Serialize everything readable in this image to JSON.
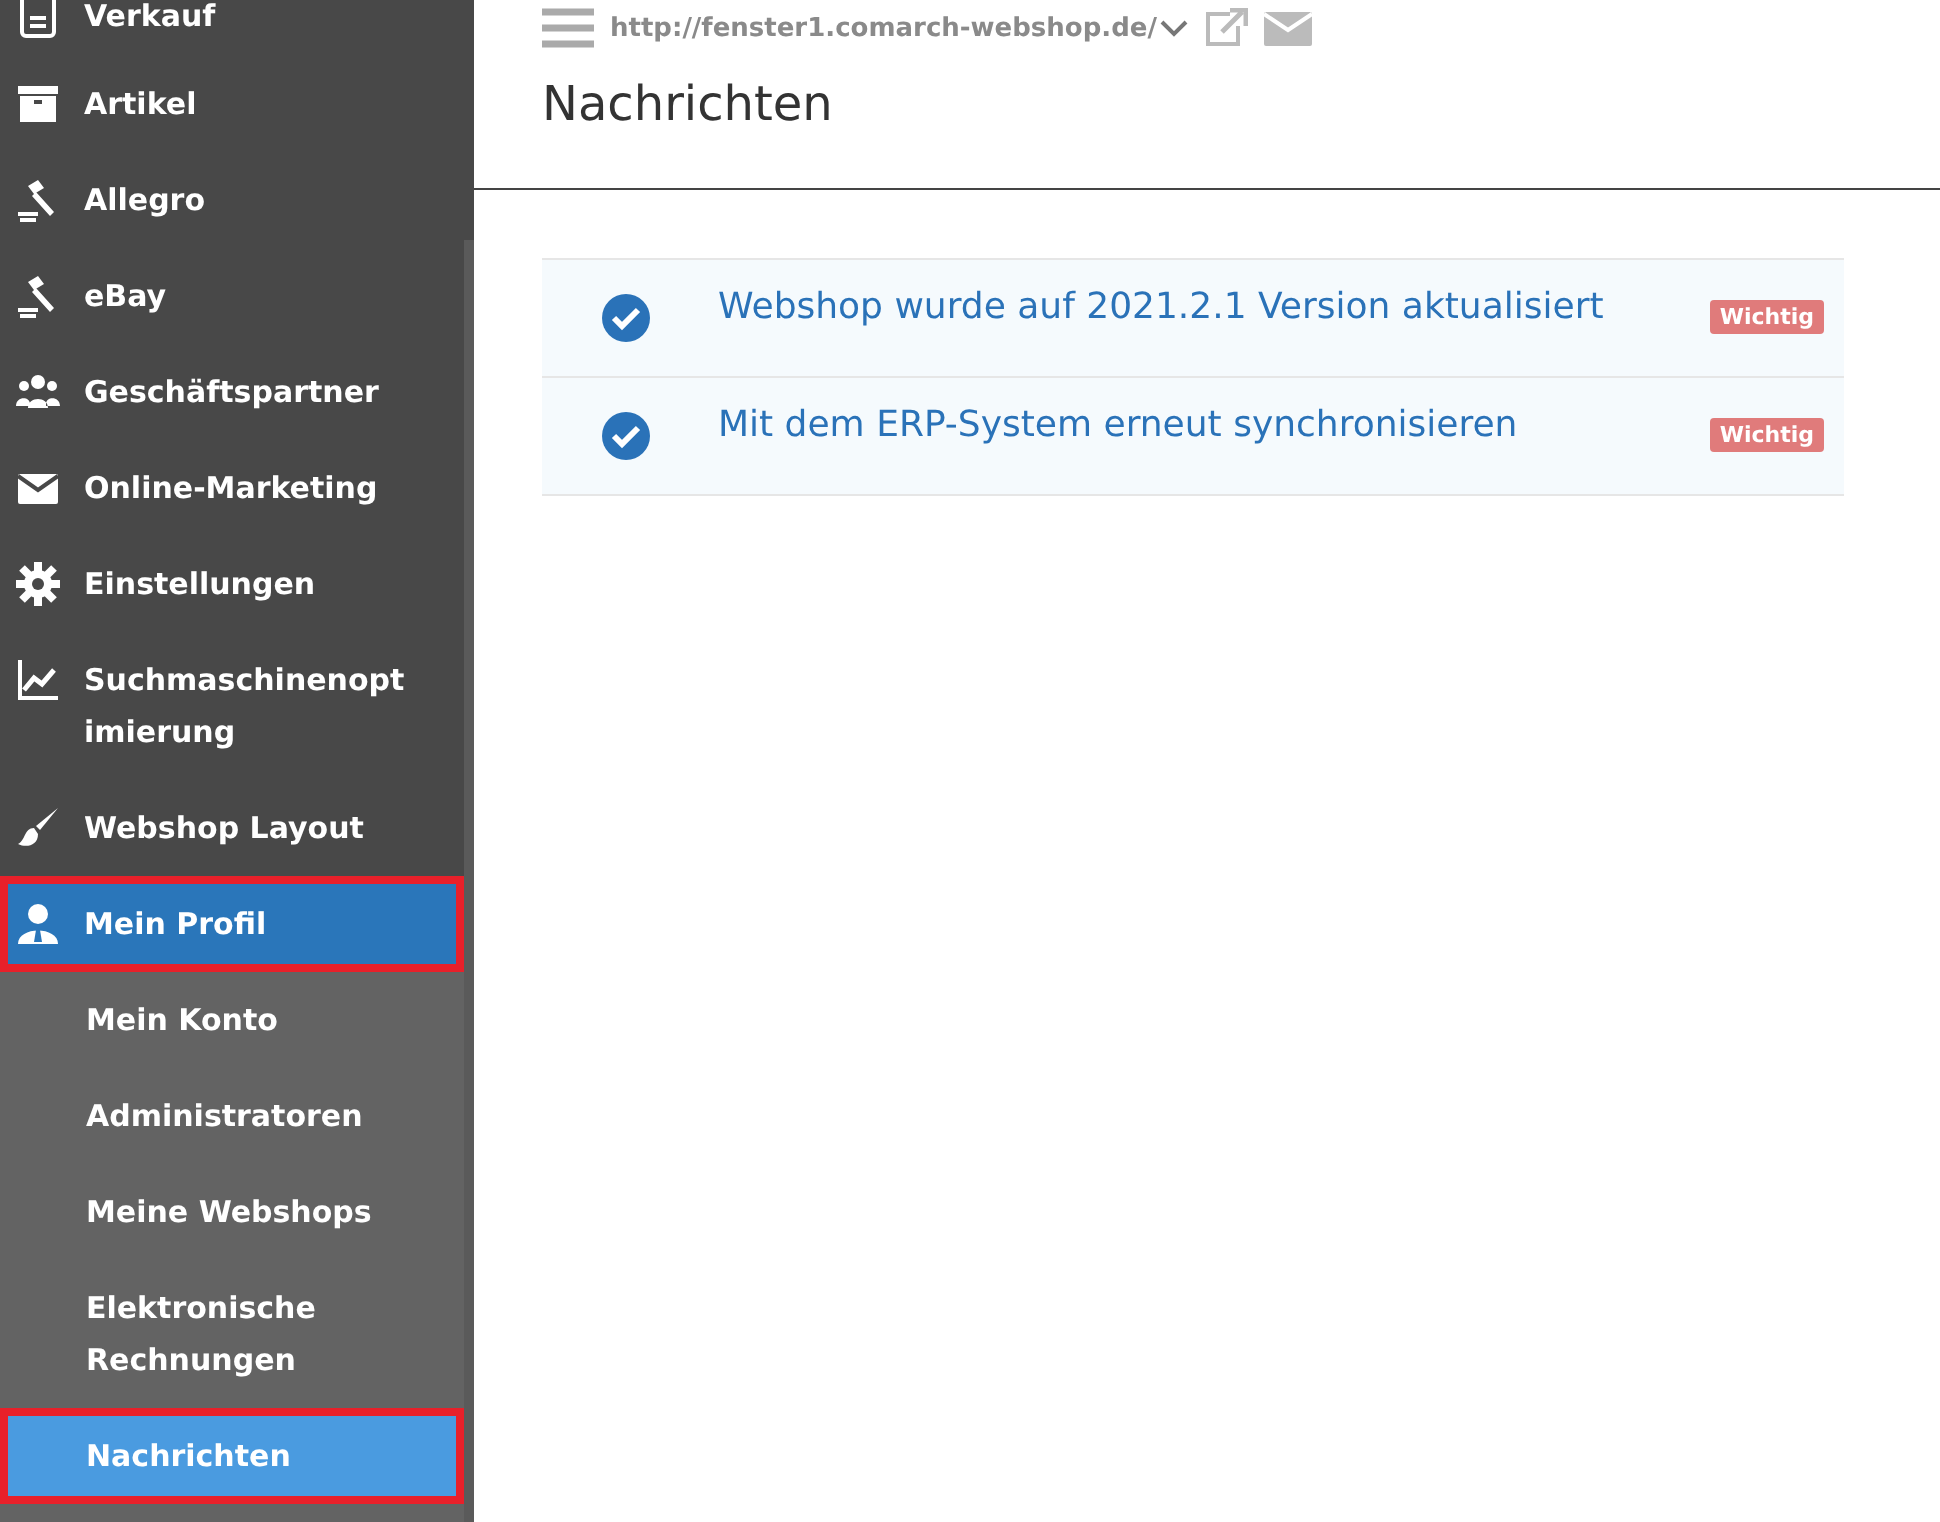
{
  "sidebar": {
    "items": [
      {
        "label": "Verkauf",
        "kind": "main",
        "selected": false,
        "highlighted": false
      },
      {
        "label": "Artikel",
        "kind": "main",
        "selected": false,
        "highlighted": false
      },
      {
        "label": "Allegro",
        "kind": "main",
        "selected": false,
        "highlighted": false
      },
      {
        "label": "eBay",
        "kind": "main",
        "selected": false,
        "highlighted": false
      },
      {
        "label": "Geschäftspartner",
        "kind": "main",
        "selected": false,
        "highlighted": false
      },
      {
        "label": "Online-Marketing",
        "kind": "main",
        "selected": false,
        "highlighted": false
      },
      {
        "label": "Einstellungen",
        "kind": "main",
        "selected": false,
        "highlighted": false
      },
      {
        "label": "Suchmaschinenoptimierung",
        "kind": "main",
        "selected": false,
        "highlighted": false
      },
      {
        "label": "Webshop Layout",
        "kind": "main",
        "selected": false,
        "highlighted": false
      },
      {
        "label": "Mein Profil",
        "kind": "main",
        "selected": true,
        "highlighted": true
      },
      {
        "label": "Mein Konto",
        "kind": "sub",
        "selected": false,
        "highlighted": false
      },
      {
        "label": "Administratoren",
        "kind": "sub",
        "selected": false,
        "highlighted": false
      },
      {
        "label": "Meine Webshops",
        "kind": "sub",
        "selected": false,
        "highlighted": false
      },
      {
        "label": "Elektronische Rechnungen",
        "kind": "sub",
        "selected": false,
        "highlighted": false
      },
      {
        "label": "Nachrichten",
        "kind": "sub",
        "selected": true,
        "highlighted": true
      }
    ]
  },
  "header": {
    "url": "http://fenster1.comarch-webshop.de/",
    "title": "Nachrichten"
  },
  "messages": [
    {
      "text": "Webshop wurde auf 2021.2.1 Version aktualisiert",
      "read": true,
      "badge": "Wichtig"
    },
    {
      "text": "Mit dem ERP-System erneut synchronisieren",
      "read": true,
      "badge": "Wichtig"
    }
  ]
}
